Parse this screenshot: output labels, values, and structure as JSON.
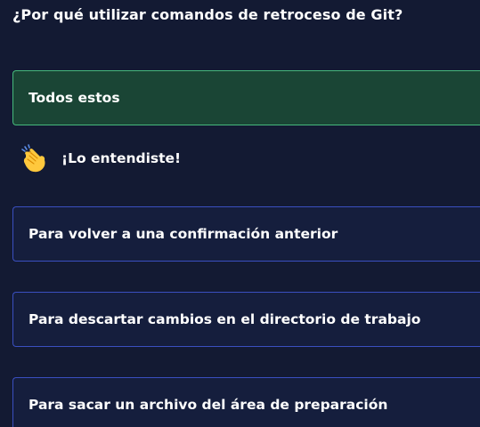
{
  "question": {
    "text": "¿Por qué utilizar comandos de retroceso de Git?"
  },
  "options": [
    {
      "label": "Todos estos",
      "state": "correct"
    },
    {
      "label": "Para volver a una confirmación anterior",
      "state": "default"
    },
    {
      "label": "Para descartar cambios en el directorio de trabajo",
      "state": "default"
    },
    {
      "label": "Para sacar un archivo del área de preparación",
      "state": "default"
    }
  ],
  "feedback": {
    "icon": "clapping-hands-icon",
    "text": "¡Lo entendiste!"
  },
  "colors": {
    "background": "#131a33",
    "option_border": "#3a4fc0",
    "correct_background": "#1a4535",
    "correct_border": "#46b87c"
  }
}
